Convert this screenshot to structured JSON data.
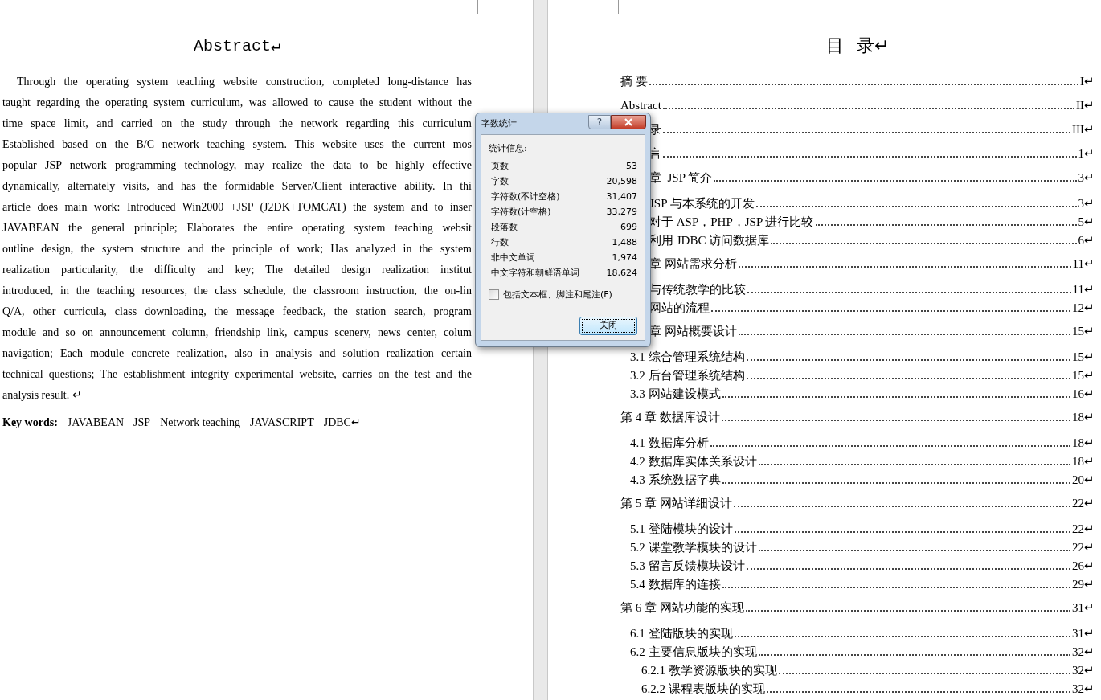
{
  "left_page": {
    "title": "Abstract↵",
    "paragraph_lines": [
      "Through the operating system teaching website construction, completed long-distance has",
      "taught regarding the operating system curriculum, was allowed to cause the student without the",
      "time space limit, and carried on the study through the network regarding this curriculum",
      "Established based on the B/C network teaching system. This website uses the current mos",
      "popular JSP network programming technology, may realize the data to be highly effective",
      "dynamically, alternately visits, and has the formidable Server/Client interactive ability. In thi",
      "article does main work: Introduced Win2000 +JSP (J2DK+TOMCAT) the system and to inser",
      "JAVABEAN the general principle; Elaborates the entire operating system teaching websit",
      "outline design, the system structure and the principle of work; Has analyzed in the system",
      "realization particularity, the difficulty and key; The detailed design realization institut",
      "introduced, in the teaching resources, the class schedule, the classroom instruction, the on-lin",
      "Q/A, other curricula, class downloading, the message feedback, the station search, program",
      "module and so on announcement column, friendship link, campus scenery, news center, colum",
      "navigation; Each module concrete realization, also in analysis and solution realization certain",
      "technical questions; The establishment integrity experimental website, carries on the test and the",
      "analysis result. ↵"
    ],
    "keywords": {
      "label": "Key words:",
      "terms": [
        "JAVABEAN",
        "JSP",
        "Network teaching",
        "JAVASCRIPT",
        "JDBC↵"
      ]
    }
  },
  "right_page": {
    "title": "目 录↵",
    "toc": [
      {
        "kind": "chapter",
        "title": "摘 要",
        "page": "I↵"
      },
      {
        "kind": "chapter",
        "title": "Abstract",
        "page": "II↵"
      },
      {
        "kind": "chapter-fragment",
        "title": "录",
        "page": "III↵"
      },
      {
        "kind": "chapter-fragment",
        "title": "言",
        "page": "1↵"
      },
      {
        "kind": "chapter-fragment",
        "title": "章  JSP 简介",
        "page": "3↵"
      },
      {
        "kind": "section-fragment",
        "title": "JSP 与本系统的开发",
        "page": "3↵"
      },
      {
        "kind": "section-fragment",
        "title": "对于 ASP，PHP，JSP 进行比较",
        "page": "5↵"
      },
      {
        "kind": "section-fragment",
        "title": "利用 JDBC 访问数据库",
        "page": "6↵"
      },
      {
        "kind": "chapter-fragment",
        "title": "章 网站需求分析",
        "page": "11↵"
      },
      {
        "kind": "section-fragment",
        "title": "与传统教学的比较",
        "page": "11↵"
      },
      {
        "kind": "section-fragment",
        "title": "网站的流程",
        "page": "12↵"
      },
      {
        "kind": "chapter-fragment",
        "title": "章 网站概要设计",
        "page": "15↵"
      },
      {
        "kind": "section",
        "title": "3.1 综合管理系统结构",
        "page": "15↵"
      },
      {
        "kind": "section",
        "title": "3.2 后台管理系统结构",
        "page": "15↵"
      },
      {
        "kind": "section",
        "title": "3.3 网站建设模式",
        "page": "16↵"
      },
      {
        "kind": "chapter",
        "title": "第 4 章 数据库设计",
        "page": "18↵"
      },
      {
        "kind": "section",
        "title": "4.1 数据库分析",
        "page": "18↵"
      },
      {
        "kind": "section",
        "title": "4.2 数据库实体关系设计",
        "page": "18↵"
      },
      {
        "kind": "section",
        "title": "4.3 系统数据字典",
        "page": "20↵"
      },
      {
        "kind": "chapter",
        "title": "第 5 章 网站详细设计",
        "page": "22↵"
      },
      {
        "kind": "section",
        "title": "5.1 登陆模块的设计",
        "page": "22↵"
      },
      {
        "kind": "section",
        "title": "5.2 课堂教学模块的设计",
        "page": "22↵"
      },
      {
        "kind": "section",
        "title": "5.3 留言反馈模块设计",
        "page": "26↵"
      },
      {
        "kind": "section",
        "title": "5.4 数据库的连接",
        "page": "29↵"
      },
      {
        "kind": "chapter",
        "title": "第 6 章 网站功能的实现",
        "page": "31↵"
      },
      {
        "kind": "section",
        "title": "6.1 登陆版块的实现",
        "page": "31↵"
      },
      {
        "kind": "section",
        "title": "6.2 主要信息版块的实现",
        "page": "32↵"
      },
      {
        "kind": "subsection",
        "title": "6.2.1 教学资源版块的实现",
        "page": "32↵"
      },
      {
        "kind": "subsection",
        "title": "6.2.2 课程表版块的实现",
        "page": "32↵"
      }
    ]
  },
  "dialog": {
    "title": "字数统计",
    "help": "?",
    "group_label": "统计信息:",
    "stats": [
      {
        "label": "页数",
        "value": "53"
      },
      {
        "label": "字数",
        "value": "20,598"
      },
      {
        "label": "字符数(不计空格)",
        "value": "31,407"
      },
      {
        "label": "字符数(计空格)",
        "value": "33,279"
      },
      {
        "label": "段落数",
        "value": "699"
      },
      {
        "label": "行数",
        "value": "1,488"
      },
      {
        "label": "非中文单词",
        "value": "1,974"
      },
      {
        "label": "中文字符和朝鲜语单词",
        "value": "18,624"
      }
    ],
    "checkbox": {
      "label": "包括文本框、脚注和尾注(F)",
      "checked": false
    },
    "close_button": "关闭"
  }
}
